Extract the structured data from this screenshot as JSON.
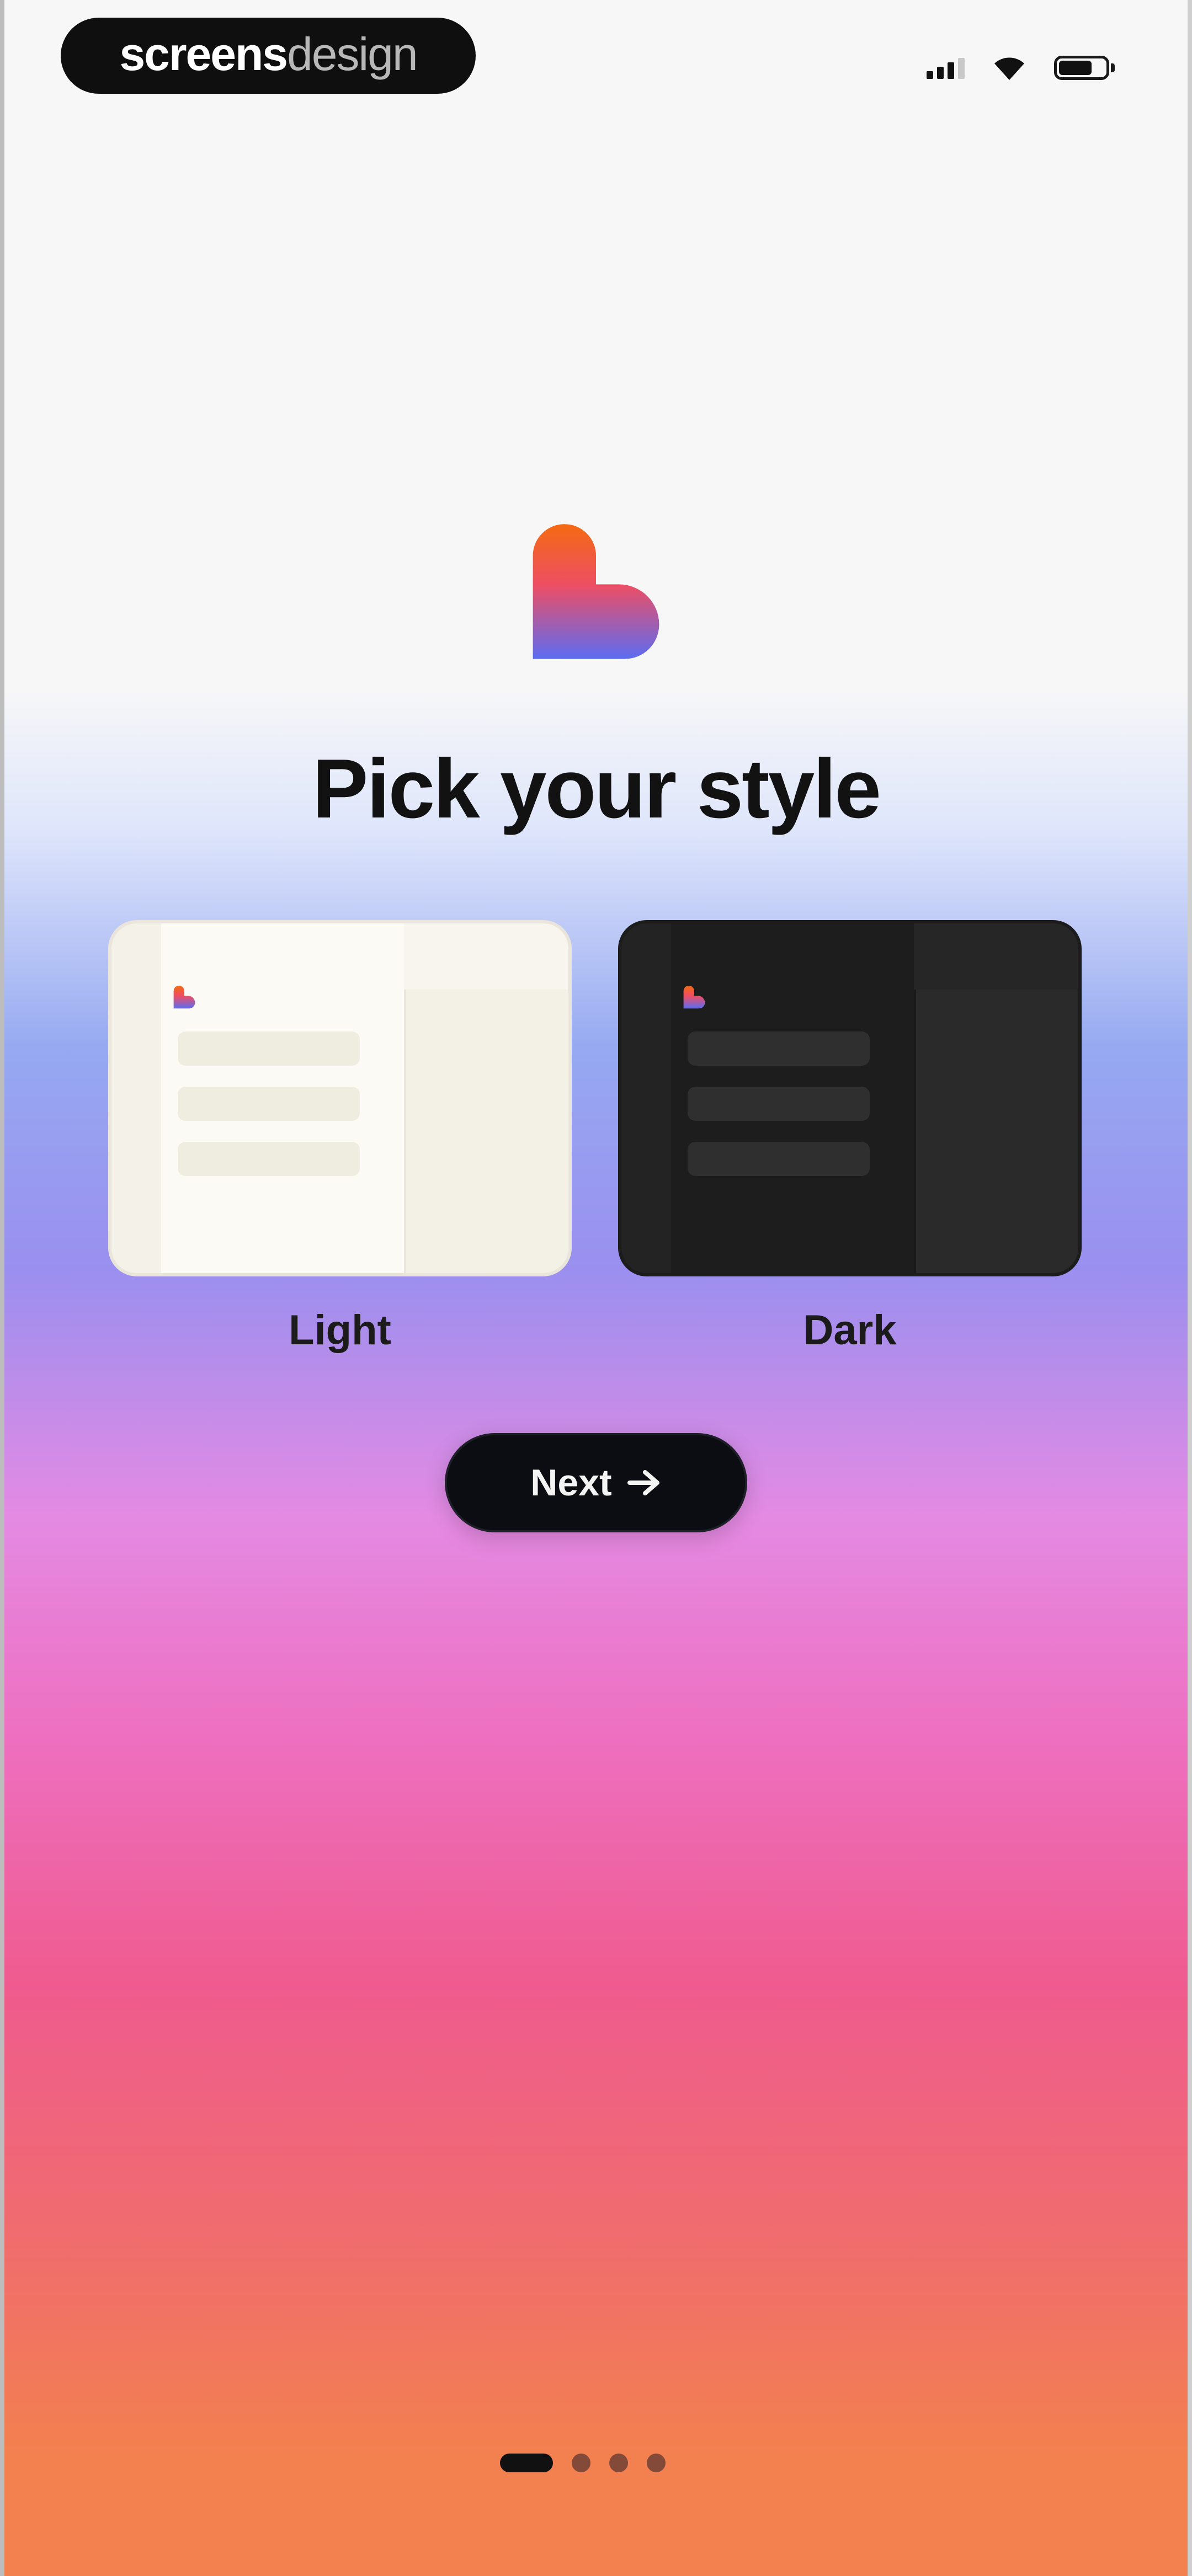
{
  "watermark": {
    "part1": "screens",
    "part2": "design"
  },
  "status_bar": {
    "icons": [
      "signal-icon",
      "wifi-icon",
      "battery-icon"
    ]
  },
  "onboarding": {
    "title": "Pick your style",
    "logo_icon": "heart-logo-icon",
    "themes": [
      {
        "label": "Light",
        "selected": false
      },
      {
        "label": "Dark",
        "selected": false
      }
    ],
    "next_button": {
      "label": "Next",
      "icon": "arrow-right-icon"
    }
  },
  "pagination": {
    "total": 4,
    "current": 1
  },
  "colors": {
    "logo_top": "#F46A12",
    "logo_bottom": "#5C6CF2",
    "button_bg": "#0C0D12",
    "gradient_blue": "#96A9F1",
    "gradient_pink": "#EE6FC0",
    "gradient_orange": "#F3804F"
  }
}
